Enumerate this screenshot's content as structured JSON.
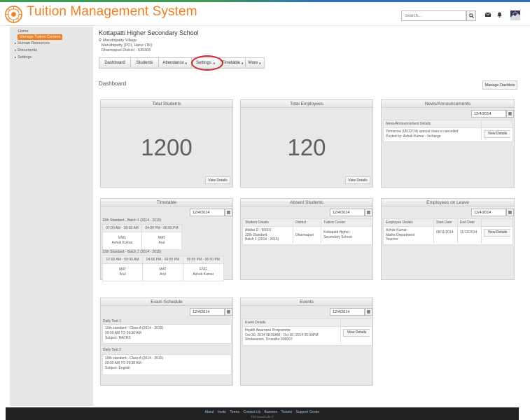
{
  "app": {
    "title": "Tuition Management System"
  },
  "header": {
    "search_placeholder": "Search...",
    "search_icon": "search-icon",
    "mail_icon": "mail-icon",
    "bell_icon": "bell-icon"
  },
  "sidebar": {
    "home": "Home",
    "active_item": "Manage Tuition Centers",
    "items": [
      "Human Resources",
      "Documents",
      "Settings"
    ]
  },
  "school": {
    "name": "Kottapatti Higher Secondary School",
    "address": [
      "Maruthipatty Village",
      "Maruthipatty (PO), Harur (TK)",
      "Dharmapuri District - 635305"
    ]
  },
  "tabs": [
    "Dashboard",
    "Students",
    "Attendance",
    "Settings",
    "Timetable",
    "More"
  ],
  "dashboard": {
    "title": "Dashboard",
    "manage_button": "Manage Dashlets"
  },
  "total_students": {
    "title": "Total Students",
    "value": "1200",
    "button": "View Details"
  },
  "total_employees": {
    "title": "Total Employees",
    "value": "120",
    "button": "View Details"
  },
  "news": {
    "title": "News/Announcements",
    "date": "12/4/2014",
    "header": "News/Announcement Details",
    "lines": [
      "Tomorrow (05/12/14) special class is cancelled",
      "Posted by: Ashok Kumar - Incharge"
    ],
    "button": "View Details"
  },
  "timetable": {
    "title": "Timetable",
    "date": "12/4/2014",
    "batches": [
      {
        "label": "12th Standard - Batch 1 (2014 - 2015)",
        "slots": [
          {
            "time": "07:00 AM - 09:00 AM",
            "subject": "ENG",
            "teacher": "Ashok Kumar"
          },
          {
            "time": "04:00 PM - 06:00 PM",
            "subject": "MAT",
            "teacher": "Arul"
          }
        ]
      },
      {
        "label": "12th Standard - Batch 2 (2014 - 2015)",
        "slots": [
          {
            "time": "07:00 AM - 09:00 AM",
            "subject": "MAT",
            "teacher": "Arul"
          },
          {
            "time": "04:00 PM - 06:00 PM",
            "subject": "MAT",
            "teacher": "Arul"
          },
          {
            "time": "05:00 PM - 06:00 PM",
            "subject": "ENG",
            "teacher": "Ashok Kumar"
          }
        ]
      }
    ]
  },
  "absent": {
    "title": "Absent Students",
    "date": "12/4/2014",
    "columns": [
      "Student Details",
      "District",
      "Tuition Center"
    ],
    "row": {
      "student": [
        "Abitha D - 50001",
        "12th Standard",
        "Batch 1 (2014 - 2015)"
      ],
      "district": "Dharmapuri",
      "center": [
        "Kottapatti Higher",
        "Secondary School"
      ]
    }
  },
  "leave": {
    "title": "Employees on Leave",
    "date": "12/4/2014",
    "columns": [
      "Employee Details",
      "Start Date",
      "End Date"
    ],
    "row": {
      "employee": [
        "Ashok Kumar",
        "Maths Department",
        "Teacher"
      ],
      "start": "09/11/2014",
      "end": "11/11/2014"
    },
    "button": "View Details"
  },
  "exam": {
    "title": "Exam Schedule",
    "date": "12/4/2014",
    "tests": [
      {
        "label": "Daily Test 1",
        "lines": [
          "12th standard - Class A (2014 - 2015)",
          "09:00 AM  TO  09:30 AM",
          "Subject: MATHS"
        ]
      },
      {
        "label": "Daily Test 2",
        "lines": [
          "10th standard - Class A (2014 - 2015)",
          "09:00 AM  TO  09:30 AM",
          "Subject: English"
        ]
      }
    ]
  },
  "events": {
    "title": "Events",
    "date": "12/4/2014",
    "header": "Event Details",
    "lines": [
      "Health Awarness Programme",
      "Oct 30, 2014  08:00AM - Oct 30, 2014  05:00PM",
      "Sholavaram, Tiruvallur 600067"
    ],
    "button": "View Details"
  },
  "footer": {
    "links": [
      "About",
      "Invite",
      "Terms",
      "Contact Us",
      "Banners",
      "Tickets",
      "Support Center"
    ],
    "copyright": "The Good Life ©"
  }
}
